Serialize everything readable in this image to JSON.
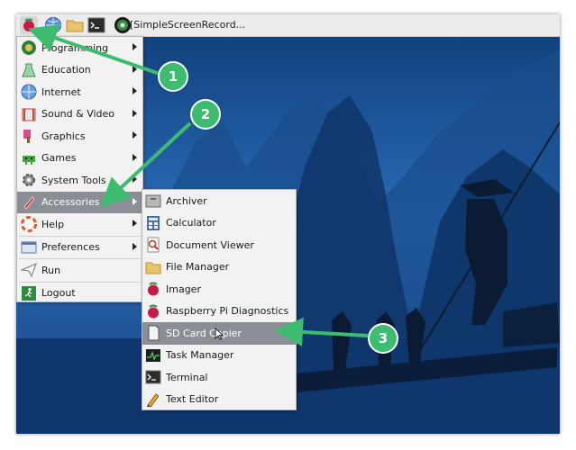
{
  "taskbar": {
    "icons": [
      "raspberry-icon",
      "globe-icon",
      "folder-icon",
      "terminal-icon",
      "recorder-icon"
    ],
    "task_label": "[SimpleScreenRecord..."
  },
  "main_menu": {
    "items": [
      {
        "label": "Programming",
        "icon": "programming-icon",
        "submenu": true
      },
      {
        "label": "Education",
        "icon": "education-icon",
        "submenu": true
      },
      {
        "label": "Internet",
        "icon": "internet-icon",
        "submenu": true
      },
      {
        "label": "Sound & Video",
        "icon": "sound-video-icon",
        "submenu": true
      },
      {
        "label": "Graphics",
        "icon": "graphics-icon",
        "submenu": true
      },
      {
        "label": "Games",
        "icon": "games-icon",
        "submenu": true
      },
      {
        "label": "System Tools",
        "icon": "system-tools-icon",
        "submenu": true
      },
      {
        "label": "Accessories",
        "icon": "accessories-icon",
        "submenu": true,
        "selected": true
      },
      {
        "label": "Help",
        "icon": "help-icon",
        "submenu": true
      },
      {
        "label": "Preferences",
        "icon": "preferences-icon",
        "submenu": true
      },
      {
        "label": "Run",
        "icon": "run-icon",
        "submenu": false
      },
      {
        "label": "Logout",
        "icon": "logout-icon",
        "submenu": false
      }
    ]
  },
  "accessories_menu": {
    "items": [
      {
        "label": "Archiver",
        "icon": "archiver-icon"
      },
      {
        "label": "Calculator",
        "icon": "calculator-icon"
      },
      {
        "label": "Document Viewer",
        "icon": "document-viewer-icon"
      },
      {
        "label": "File Manager",
        "icon": "file-manager-icon"
      },
      {
        "label": "Imager",
        "icon": "imager-icon"
      },
      {
        "label": "Raspberry Pi Diagnostics",
        "icon": "raspberry-diagnostics-icon"
      },
      {
        "label": "SD Card Copier",
        "icon": "sd-card-icon",
        "selected": true
      },
      {
        "label": "Task Manager",
        "icon": "task-manager-icon"
      },
      {
        "label": "Terminal",
        "icon": "terminal-app-icon"
      },
      {
        "label": "Text Editor",
        "icon": "text-editor-icon"
      }
    ]
  },
  "annotations": {
    "badges": [
      "1",
      "2",
      "3"
    ],
    "color": "#3dbb6e"
  },
  "colors": {
    "menu_bg": "#f2f2f2",
    "selected_bg": "#8b8f95",
    "taskbar_bg": "#ececec",
    "sky": "#1c4a8a"
  }
}
